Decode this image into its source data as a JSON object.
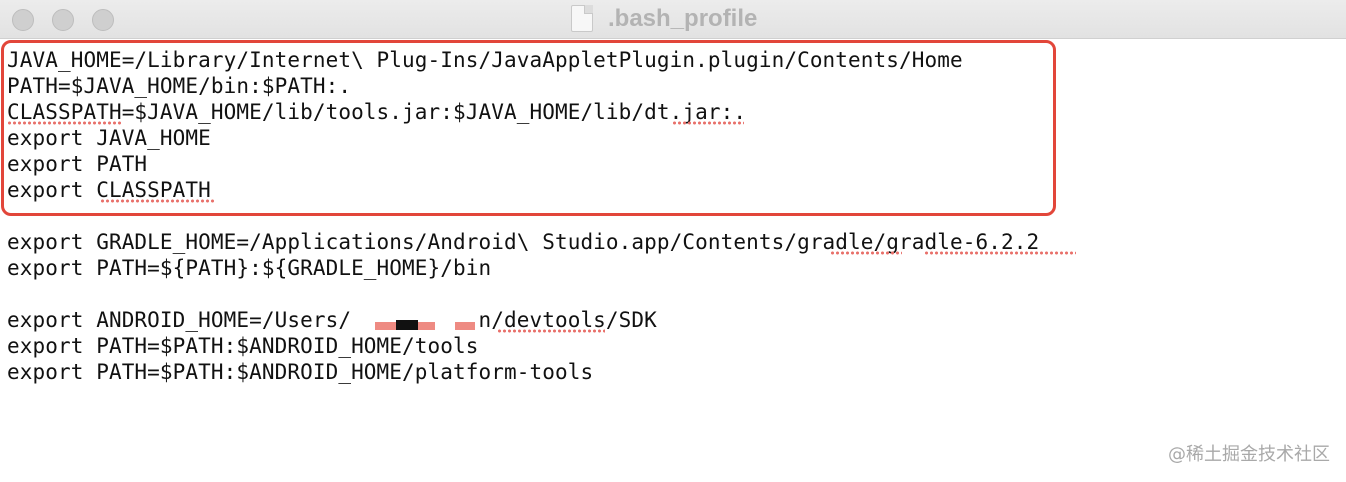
{
  "window": {
    "title": ".bash_profile"
  },
  "editor": {
    "lines": [
      "JAVA_HOME=/Library/Internet\\ Plug-Ins/JavaAppletPlugin.plugin/Contents/Home",
      "PATH=$JAVA_HOME/bin:$PATH:.",
      "CLASSPATH=$JAVA_HOME/lib/tools.jar:$JAVA_HOME/lib/dt.jar:.",
      "export JAVA_HOME",
      "export PATH",
      "export CLASSPATH",
      "",
      "export GRADLE_HOME=/Applications/Android\\ Studio.app/Contents/gradle/gradle-6.2.2",
      "export PATH=${PATH}:${GRADLE_HOME}/bin",
      "",
      "export ANDROID_HOME=/Users/          n/devtools/SDK",
      "export PATH=$PATH:$ANDROID_HOME/tools",
      "export PATH=$PATH:$ANDROID_HOME/platform-tools"
    ]
  },
  "watermark": "@稀土掘金技术社区",
  "colors": {
    "highlight": "#e2463a",
    "spellcheck": "#e8706a",
    "titlebar": "#e6e6e6"
  }
}
